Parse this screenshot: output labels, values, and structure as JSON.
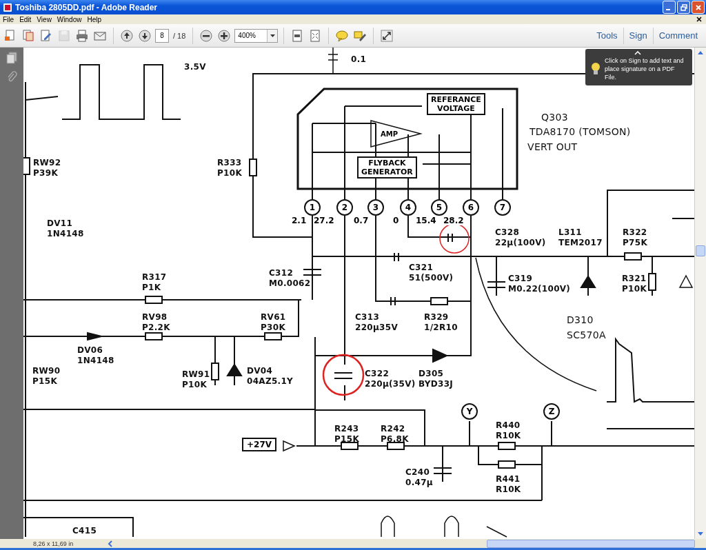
{
  "window": {
    "title": "Toshiba 2805DD.pdf - Adobe Reader"
  },
  "menu": [
    "File",
    "Edit",
    "View",
    "Window",
    "Help"
  ],
  "toolbar": [
    [
      {
        "kind": "create",
        "disabled": false
      },
      {
        "kind": "combine",
        "disabled": false
      },
      {
        "kind": "edit",
        "disabled": false
      },
      {
        "kind": "save",
        "disabled": true
      },
      {
        "kind": "print",
        "disabled": false
      },
      {
        "kind": "email",
        "disabled": false
      }
    ],
    [
      {
        "kind": "prev",
        "disabled": false
      },
      {
        "kind": "next",
        "disabled": false
      },
      {
        "kind": "page",
        "value": "8",
        "disabled": false
      },
      {
        "kind": "count",
        "text": "/ 18",
        "disabled": false
      }
    ],
    [
      {
        "kind": "zoom_out",
        "disabled": false
      },
      {
        "kind": "zoom_in",
        "disabled": false
      },
      {
        "kind": "zoom",
        "value": "400%",
        "disabled": false
      }
    ],
    [
      {
        "kind": "fit_page",
        "disabled": false
      },
      {
        "kind": "fit_width",
        "disabled": false
      }
    ],
    [
      {
        "kind": "comment",
        "disabled": false
      },
      {
        "kind": "highlight",
        "disabled": false
      }
    ],
    [
      {
        "kind": "full_screen",
        "disabled": false
      }
    ]
  ],
  "panes": [
    "Tools",
    "Sign",
    "Comment"
  ],
  "document": {
    "parts": [
      {
        "ref": "0.1"
      },
      {
        "ref": "3.5V"
      },
      {
        "ref": "RW92",
        "value": "P39K"
      },
      {
        "ref": "R333",
        "value": "P10K"
      },
      {
        "ref": "DV11",
        "value": "1N4148"
      },
      {
        "ref": "Q303"
      },
      {
        "ref": "TDA8170 (TOMSON)"
      },
      {
        "ref": "VERT OUT"
      },
      {
        "ref": "C328",
        "value": "22µ(100V)"
      },
      {
        "ref": "L311",
        "value": "TEM2017"
      },
      {
        "ref": "R322",
        "value": "P75K"
      },
      {
        "ref": "C312",
        "value": "M0.0062"
      },
      {
        "ref": "R317",
        "value": "P1K"
      },
      {
        "ref": "C321",
        "value": "51(500V)"
      },
      {
        "ref": "C319",
        "value": "M0.22(100V)"
      },
      {
        "ref": "R321",
        "value": "P10K"
      },
      {
        "ref": "RV98",
        "value": "P2.2K"
      },
      {
        "ref": "RV61",
        "value": "P30K"
      },
      {
        "ref": "C313",
        "value": "220µ35V"
      },
      {
        "ref": "R329",
        "value": "1/2R10"
      },
      {
        "ref": "D310",
        "value": "SC570A"
      },
      {
        "ref": "DV06",
        "value": "1N4148"
      },
      {
        "ref": "RW90",
        "value": "P15K"
      },
      {
        "ref": "RW91",
        "value": "P10K"
      },
      {
        "ref": "DV04",
        "value": "04AZ5.1Y"
      },
      {
        "ref": "C322",
        "value": "220µ(35V)"
      },
      {
        "ref": "D305",
        "value": "BYD33J"
      },
      {
        "ref": "R243",
        "value": "P15K"
      },
      {
        "ref": "R242",
        "value": "P6.8K"
      },
      {
        "ref": "R440",
        "value": "R10K"
      },
      {
        "ref": "C240",
        "value": "0.47µ"
      },
      {
        "ref": "R441",
        "value": "R10K"
      },
      {
        "ref": "C415"
      }
    ],
    "blocks": [
      {
        "lines": [
          "REFERANCE",
          "VOLTAGE"
        ]
      },
      {
        "lines": [
          "AMP"
        ]
      },
      {
        "lines": [
          "FLYBACK",
          "GENERATOR"
        ]
      }
    ],
    "pins": [
      "1",
      "2",
      "3",
      "4",
      "5",
      "6",
      "7"
    ],
    "voltages": [
      "2.1",
      "27.2",
      "0.7",
      "0",
      "15.4",
      "28.2"
    ],
    "nodes": [
      "Y",
      "Z"
    ],
    "supply": "+27V"
  },
  "tooltip": {
    "text": "Click on Sign to add text and place signature on a PDF File."
  },
  "status_bar": {
    "page_size": "8,26 x 11,69 in"
  }
}
